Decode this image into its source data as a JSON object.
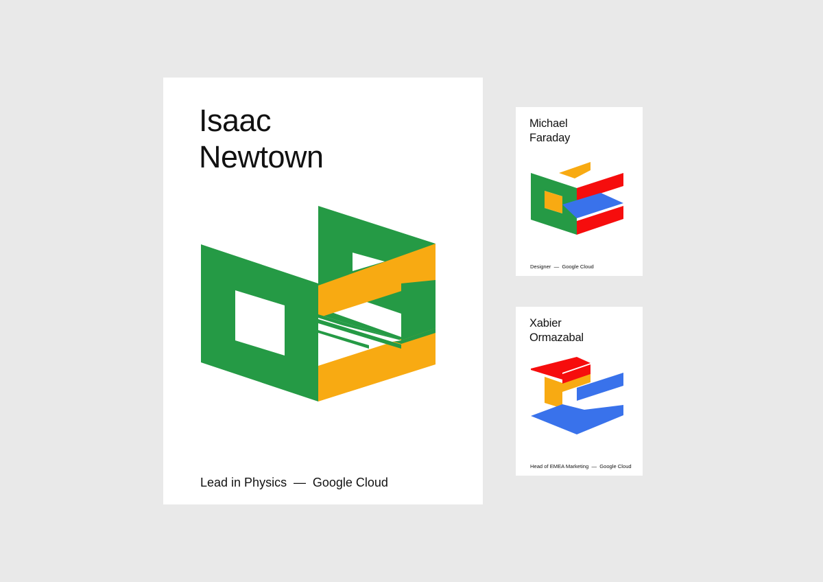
{
  "colors": {
    "background": "#e9e9e9",
    "card": "#ffffff",
    "green": "#259a45",
    "yellow": "#f8aa12",
    "red": "#f60d0d",
    "blue": "#3972eb"
  },
  "cards": [
    {
      "name_line1": "Isaac",
      "name_line2": "Newtown",
      "role": "Lead in Physics",
      "separator": "—",
      "company": "Google Cloud"
    },
    {
      "name_line1": "Michael",
      "name_line2": "Faraday",
      "role": "Designer",
      "separator": "—",
      "company": "Google Cloud"
    },
    {
      "name_line1": "Xabier",
      "name_line2": "Ormazabal",
      "role": "Head of EMEA Marketing",
      "separator": "—",
      "company": "Google Cloud"
    }
  ]
}
